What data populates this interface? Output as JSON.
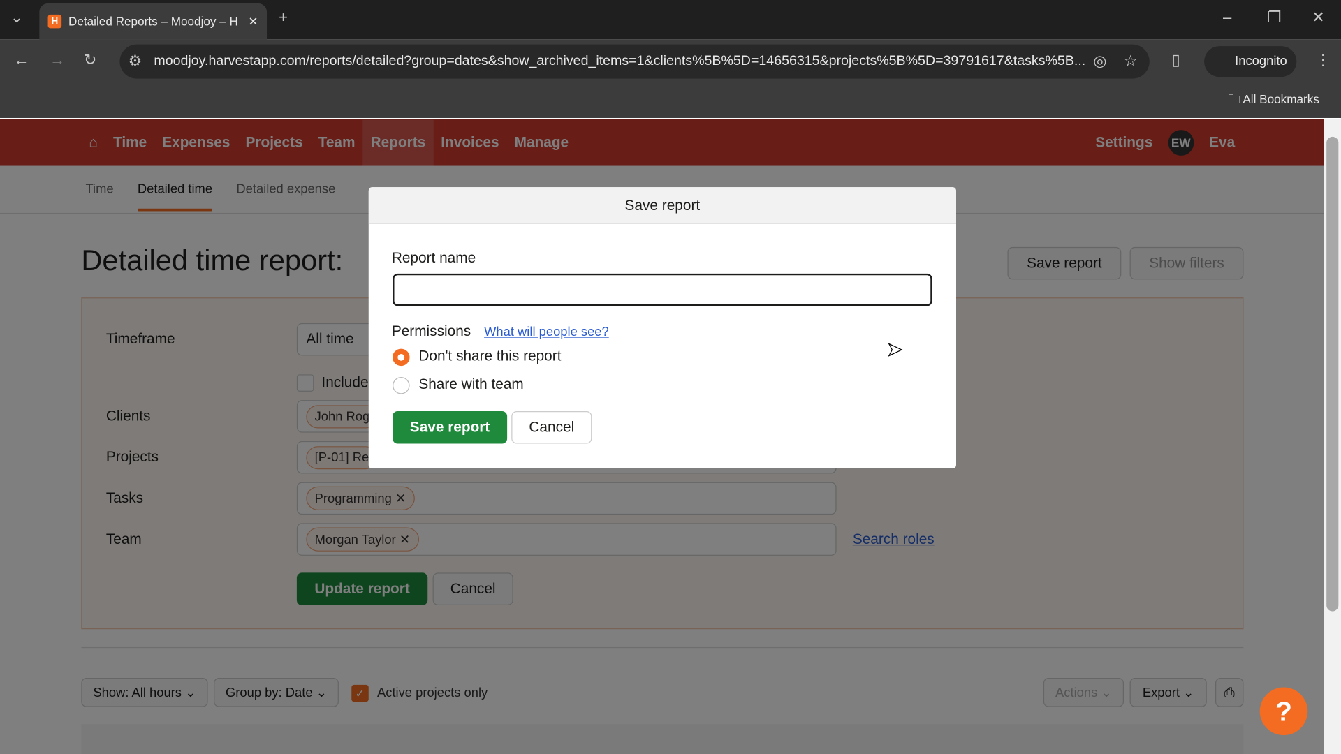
{
  "browser": {
    "tab_title": "Detailed Reports – Moodjoy – H",
    "url": "moodjoy.harvestapp.com/reports/detailed?group=dates&show_archived_items=1&clients%5B%5D=14656315&projects%5B%5D=39791617&tasks%5B...",
    "incognito": "Incognito",
    "bookmarks": "All Bookmarks"
  },
  "nav": {
    "items": [
      "Time",
      "Expenses",
      "Projects",
      "Team",
      "Reports",
      "Invoices",
      "Manage"
    ],
    "active": "Reports",
    "settings": "Settings",
    "avatar": "EW",
    "user": "Eva",
    "color": "#d13a2f"
  },
  "subtabs": [
    "Time",
    "Detailed time",
    "Detailed expense"
  ],
  "page": {
    "title": "Detailed time report:",
    "save_report": "Save report",
    "show_filters": "Show filters"
  },
  "filters": {
    "timeframe_label": "Timeframe",
    "timeframe_value": "All time",
    "include_label": "Include",
    "clients_label": "Clients",
    "clients_chip": "John Rog",
    "projects_label": "Projects",
    "projects_chip": "[P-01] Re",
    "tasks_label": "Tasks",
    "tasks_chip": "Programming",
    "team_label": "Team",
    "team_chip": "Morgan Taylor",
    "search_roles": "Search roles",
    "update": "Update report",
    "cancel": "Cancel"
  },
  "bottom": {
    "show": "Show: All hours",
    "group": "Group by: Date",
    "active_only": "Active projects only",
    "actions": "Actions",
    "export": "Export"
  },
  "modal": {
    "title": "Save report",
    "name_label": "Report name",
    "name_value": "",
    "permissions": "Permissions",
    "help_link": "What will people see?",
    "options": [
      "Don't share this report",
      "Share with team"
    ],
    "selected": 0,
    "save": "Save report",
    "cancel": "Cancel"
  },
  "help": "?"
}
